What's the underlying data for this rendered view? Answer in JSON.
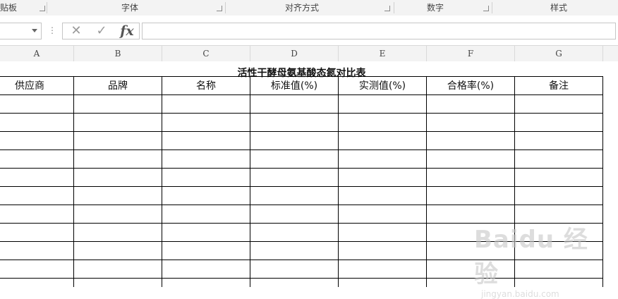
{
  "ribbon": {
    "groups": [
      {
        "label": "贴板"
      },
      {
        "label": "字体"
      },
      {
        "label": "对齐方式"
      },
      {
        "label": "数字"
      },
      {
        "label": "样式"
      }
    ]
  },
  "formula_bar": {
    "cancel_symbol": "✕",
    "enter_symbol": "✓",
    "fx_symbol": "fx",
    "formula_value": "",
    "name_box_value": ""
  },
  "columns": [
    "A",
    "B",
    "C",
    "D",
    "E",
    "F",
    "G"
  ],
  "sheet": {
    "title": "活性干酵母氨基酸态氮对比表",
    "headers": [
      "供应商",
      "品牌",
      "名称",
      "标准值(%)",
      "实测值(%)",
      "合格率(%)",
      "备注"
    ]
  },
  "watermark": {
    "brand": "Baidu 经验",
    "url": "jingyan.baidu.com"
  }
}
